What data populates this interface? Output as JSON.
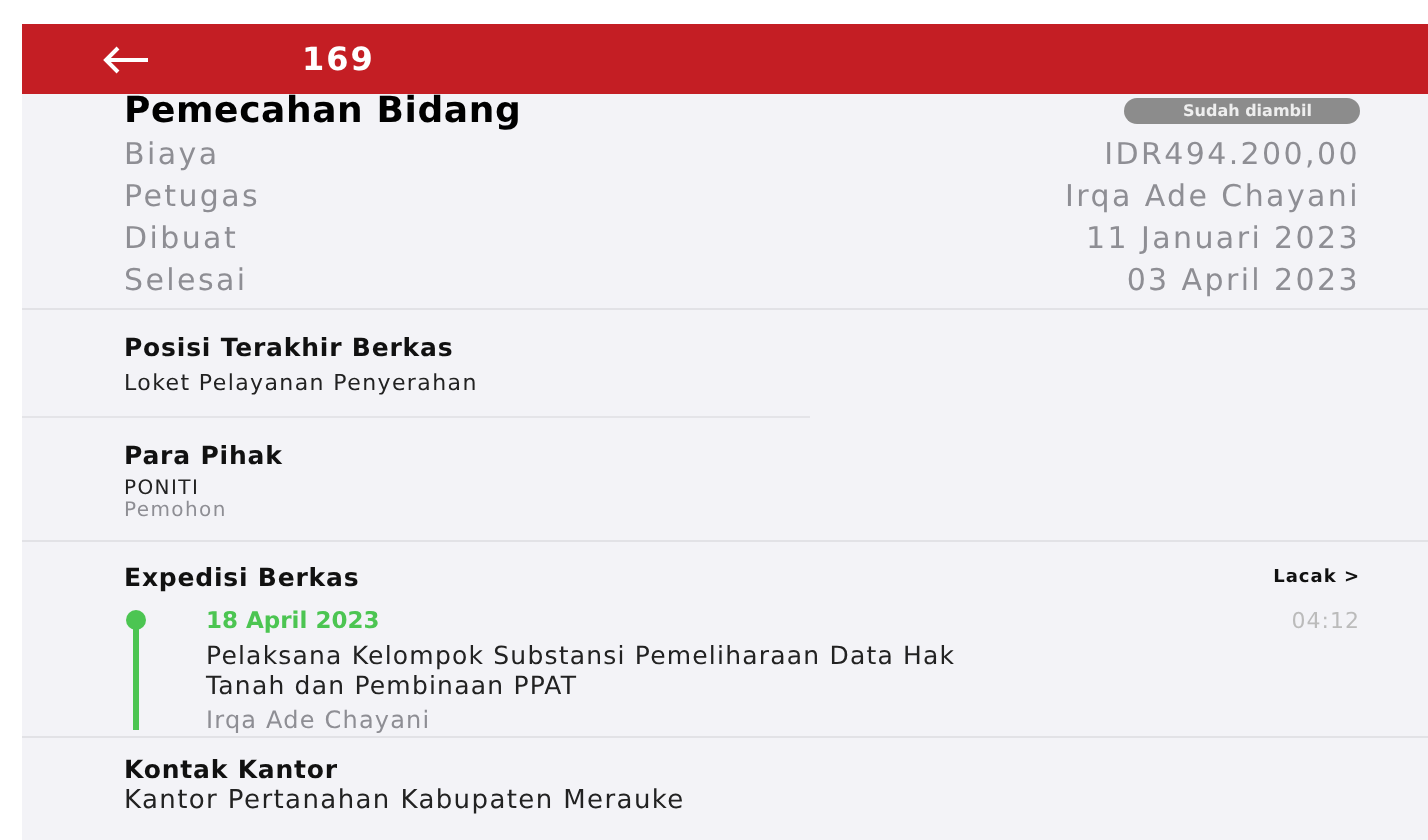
{
  "header": {
    "title": "169"
  },
  "summary": {
    "title": "Pemecahan Bidang",
    "status": "Sudah diambil",
    "rows": [
      {
        "label": "Biaya",
        "value": "IDR494.200,00"
      },
      {
        "label": "Petugas",
        "value": "Irqa Ade Chayani"
      },
      {
        "label": "Dibuat",
        "value": "11 Januari 2023"
      },
      {
        "label": "Selesai",
        "value": "03 April 2023"
      }
    ]
  },
  "position": {
    "heading": "Posisi Terakhir Berkas",
    "value": "Loket Pelayanan Penyerahan"
  },
  "parties": {
    "heading": "Para Pihak",
    "name": "PONITI",
    "role": "Pemohon"
  },
  "expedition": {
    "heading": "Expedisi Berkas",
    "link": "Lacak >",
    "entries": [
      {
        "date": "18 April 2023",
        "time": "04:12",
        "description": "Pelaksana Kelompok Substansi Pemeliharaan Data Hak Tanah dan Pembinaan PPAT",
        "officer": "Irqa Ade Chayani",
        "color": "#4cc552"
      }
    ]
  },
  "office": {
    "heading": "Kontak Kantor",
    "name": "Kantor Pertanahan Kabupaten Merauke"
  }
}
